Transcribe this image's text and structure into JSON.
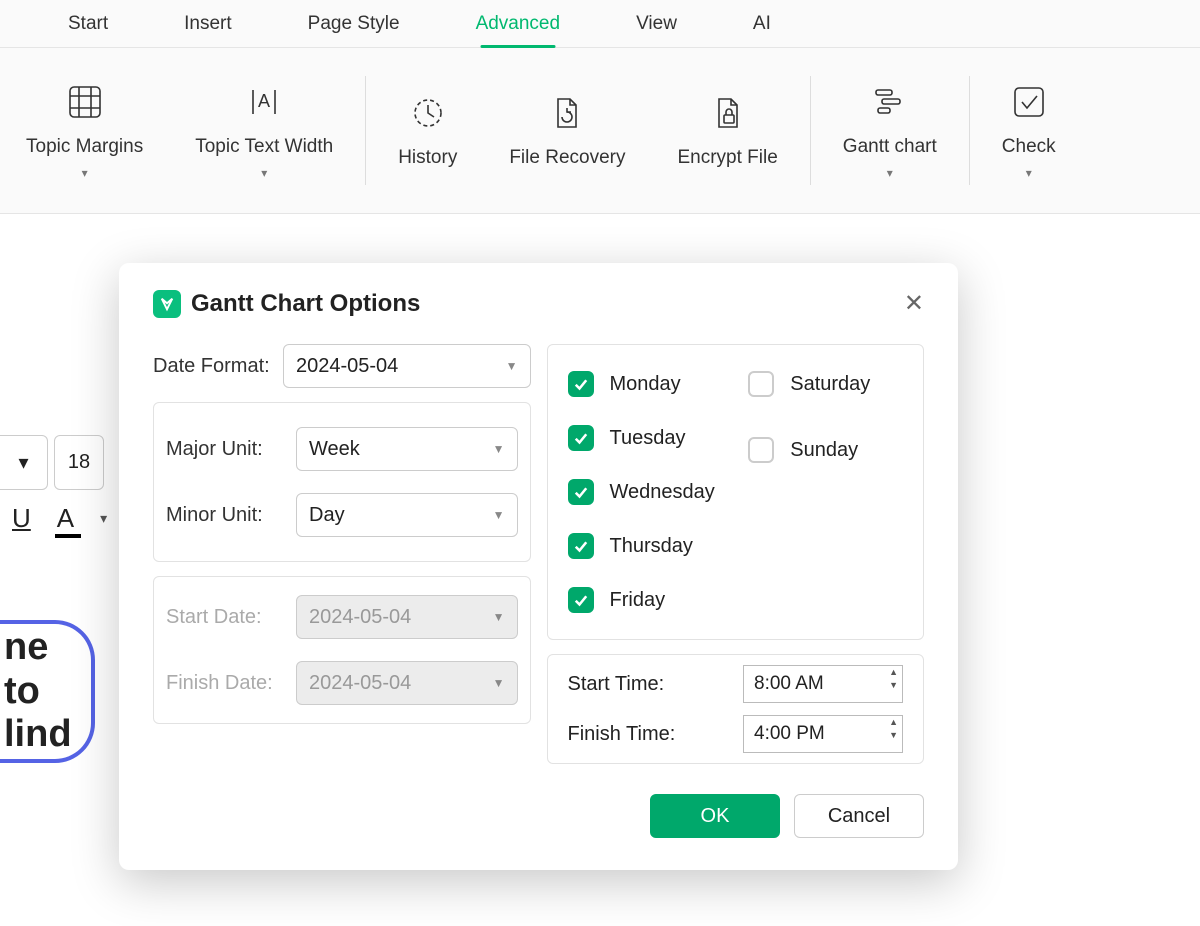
{
  "tabs": [
    "Start",
    "Insert",
    "Page Style",
    "Advanced",
    "View",
    "AI"
  ],
  "activeTab": "Advanced",
  "toolbar": {
    "topicMargins": "Topic Margins",
    "topicTextWidth": "Topic Text Width",
    "history": "History",
    "fileRecovery": "File Recovery",
    "encryptFile": "Encrypt File",
    "ganttChart": "Gantt chart",
    "check": "Check"
  },
  "leftFragment": {
    "fontSize": "18",
    "word1": "ne to",
    "word2": "lind"
  },
  "dialog": {
    "title": "Gantt Chart Options",
    "labels": {
      "dateFormat": "Date Format:",
      "majorUnit": "Major Unit:",
      "minorUnit": "Minor Unit:",
      "startDate": "Start Date:",
      "finishDate": "Finish Date:",
      "startTime": "Start Time:",
      "finishTime": "Finish Time:"
    },
    "values": {
      "dateFormat": "2024-05-04",
      "majorUnit": "Week",
      "minorUnit": "Day",
      "startDate": "2024-05-04",
      "finishDate": "2024-05-04",
      "startTime": "8:00 AM",
      "finishTime": "4:00 PM"
    },
    "days": {
      "monday": "Monday",
      "tuesday": "Tuesday",
      "wednesday": "Wednesday",
      "thursday": "Thursday",
      "friday": "Friday",
      "saturday": "Saturday",
      "sunday": "Sunday"
    },
    "dayChecked": {
      "monday": true,
      "tuesday": true,
      "wednesday": true,
      "thursday": true,
      "friday": true,
      "saturday": false,
      "sunday": false
    },
    "buttons": {
      "ok": "OK",
      "cancel": "Cancel"
    }
  }
}
